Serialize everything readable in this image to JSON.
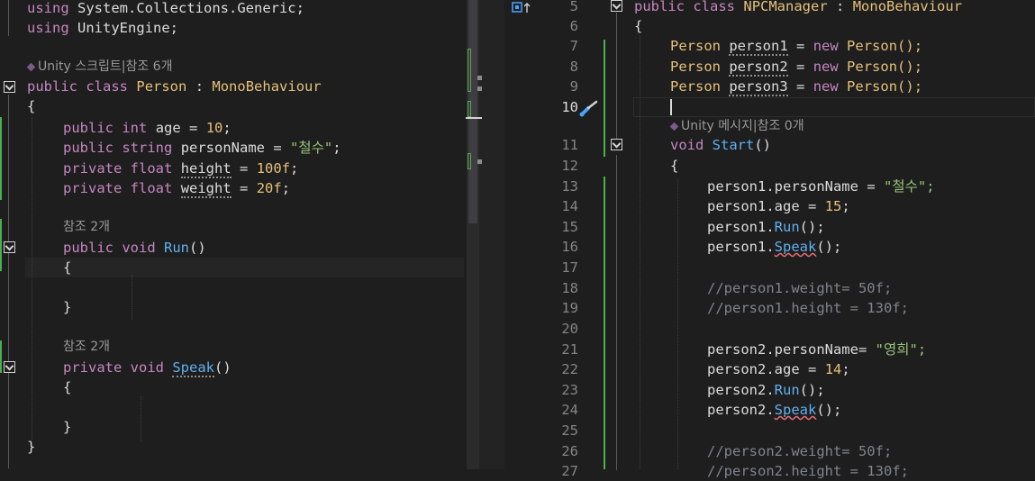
{
  "left_editor": {
    "lines": [
      {
        "t": "using System.Collections.Generic;"
      },
      {
        "t": "using UnityEngine;"
      },
      {
        "lens": "Unity 스크립트|참조 6개"
      },
      {
        "t": "public class Person : MonoBehaviour"
      },
      {
        "t": "{"
      },
      {
        "t": "public int age = 10;"
      },
      {
        "t": "public string personName = \"철수\";"
      },
      {
        "t": "private float height = 100f;"
      },
      {
        "t": "private float weight = 20f;"
      },
      {
        "lens": "참조 2개"
      },
      {
        "t": "public void Run()"
      },
      {
        "t": "{"
      },
      {
        "t": "}"
      },
      {
        "lens": "참조 2개"
      },
      {
        "t": "private void Speak()"
      },
      {
        "t": "{"
      },
      {
        "t": "}"
      },
      {
        "t": "}"
      }
    ],
    "tokens": {
      "using1": "using",
      "sys": "System.Collections.Generic;",
      "using2": "using",
      "ue": "UnityEngine",
      "semi": ";",
      "lens1": "Unity 스크립트|참조 6개",
      "public": "public",
      "class": "class",
      "person": "Person",
      "colon": ":",
      "mono": "MonoBehaviour",
      "lbrace": "{",
      "int": "int",
      "age": "age",
      "eq": "=",
      "ten": "10",
      "string": "string",
      "pname": "personName",
      "cheolsu": "\"철수\"",
      "private": "private",
      "float": "float",
      "height": "height",
      "hval": "100f",
      "weight": "weight",
      "wval": "20f",
      "lens2": "참조 2개",
      "void": "void",
      "run": "Run",
      "parens": "()",
      "rbrace": "}",
      "speak": "Speak"
    }
  },
  "right_editor": {
    "line_numbers": [
      "5",
      "6",
      "7",
      "8",
      "9",
      "10",
      "11",
      "12",
      "13",
      "14",
      "15",
      "16",
      "17",
      "18",
      "19",
      "20",
      "21",
      "22",
      "23",
      "24",
      "25",
      "26",
      "27"
    ],
    "indicator_icon": "bookmark-up-icon",
    "brush_icon": "paintbrush-icon",
    "lens": "Unity 메시지|참조 0개",
    "tokens": {
      "public": "public",
      "class": "class",
      "npc": "NPCManager",
      "colon": ":",
      "mono": "MonoBehaviour",
      "lbrace": "{",
      "rbrace": "}",
      "person": "Person",
      "p1": "person1",
      "p2": "person2",
      "p3": "person3",
      "eq": "=",
      "new": "new",
      "ctor": "Person();",
      "void": "void",
      "start": "Start",
      "parens": "()",
      "p1name": "person1.personName",
      "cheolsu": "\"철수\";",
      "p1age": "person1.age",
      "fifteen": "15",
      "semi": ";",
      "p1run": "person1.",
      "run": "Run",
      "call": "();",
      "p1speak": "person1.",
      "speak": "Speak",
      "c1": "//person1.weight= 50f;",
      "c2": "//person1.height = 130f;",
      "p2name": "person2.personName=",
      "younghee": "\"영희\";",
      "p2age": "person2.age",
      "fourteen": "14",
      "p2run": "person2.",
      "p2speak": "person2.",
      "c3": "//person2.weight= 50f;",
      "c4": "//person2.height = 130f;"
    }
  },
  "colors": {
    "keyword": "#c586c0",
    "type": "#e5c07b",
    "string": "#98c379",
    "number": "#e5c07b",
    "method": "#61afef",
    "comment": "#7f848e",
    "background": "#1e1e1e"
  }
}
